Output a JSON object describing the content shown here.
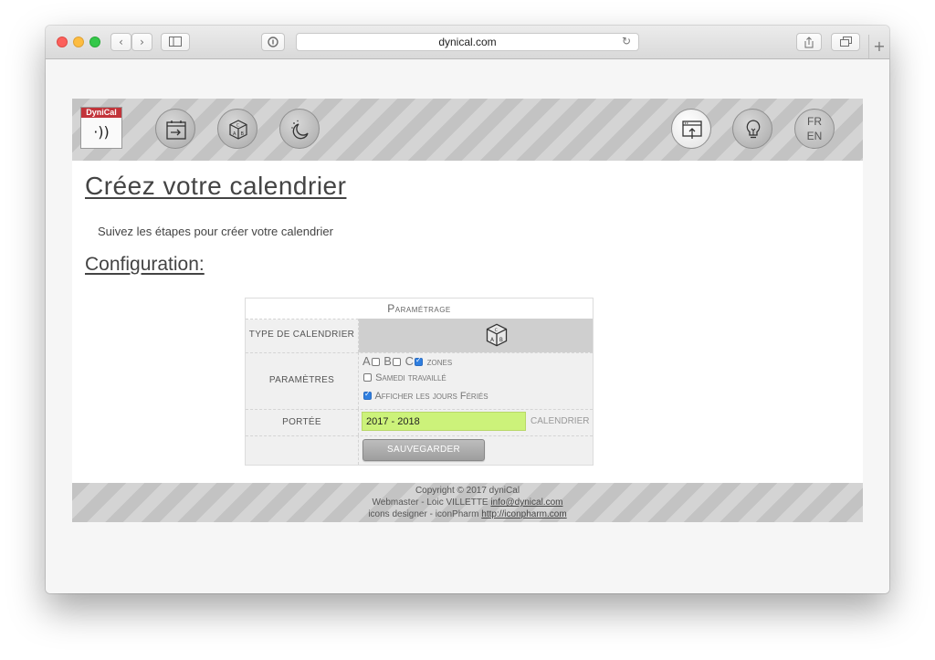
{
  "browser": {
    "url": "dynical.com",
    "back_glyph": "‹",
    "forward_glyph": "›",
    "new_tab_glyph": "+"
  },
  "header": {
    "logo_text": "DyniCal",
    "logo_glyph": "·))",
    "nav_icons": [
      "calendar-import-icon",
      "dice-abc-icon",
      "moon-icon"
    ],
    "right_icons": [
      "export-window-icon",
      "lightbulb-icon"
    ],
    "lang_fr": "FR",
    "lang_en": "EN"
  },
  "main": {
    "title": "Créez votre calendrier",
    "intro": "Suivez les étapes pour créer votre calendrier",
    "section_title": "Configuration:"
  },
  "form": {
    "header": "Paramétrage",
    "type_label": "type de calendrier",
    "type_icon": "dice-abc-icon",
    "params_label": "paramètres",
    "zone_a": "A",
    "zone_b": "B",
    "zone_c": "C",
    "zones_label": "zones",
    "zones": {
      "a": false,
      "b": false,
      "c": true
    },
    "samedi_label": "Samedi travaillé",
    "samedi_checked": false,
    "feries_label": "Afficher les jours Fériés",
    "feries_checked": true,
    "portee_label": "portée",
    "portee_value": "2017 - 2018",
    "portee_suffix": "calendrier",
    "save_label": "sauvegarder"
  },
  "footer": {
    "copyright": "Copyright © 2017 dyniCal",
    "webmaster_label": "Webmaster - Loic VILLETTE",
    "webmaster_email": "info@dynical.com",
    "icons_label": "icons designer - iconPharm",
    "icons_url": "http://iconpharm.com"
  }
}
